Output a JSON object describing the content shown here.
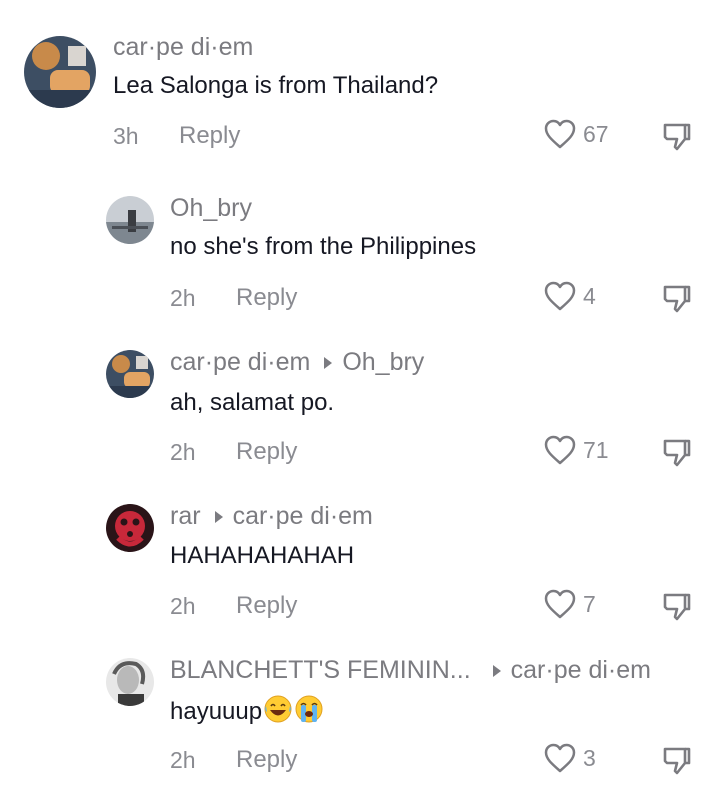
{
  "comments": [
    {
      "username": "car·pe di·em",
      "reply_to": "",
      "text": "Lea Salonga is from Thailand?",
      "time": "3h",
      "reply_label": "Reply",
      "likes": "67",
      "avatar_icon": "user-photo-avatar"
    },
    {
      "username": "Oh_bry",
      "reply_to": "",
      "text": "no she's from the Philippines",
      "time": "2h",
      "reply_label": "Reply",
      "likes": "4",
      "avatar_icon": "user-photo-avatar"
    },
    {
      "username": "car·pe di·em",
      "reply_to": "Oh_bry",
      "text": "ah, salamat po.",
      "time": "2h",
      "reply_label": "Reply",
      "likes": "71",
      "avatar_icon": "user-photo-avatar"
    },
    {
      "username": "rar",
      "reply_to": "car·pe di·em",
      "text": "HAHAHAHAHAH",
      "time": "2h",
      "reply_label": "Reply",
      "likes": "7",
      "avatar_icon": "user-photo-avatar"
    },
    {
      "username": "BLANCHETT'S FEMININ...",
      "reply_to": "car·pe di·em",
      "text": "hayuuup",
      "emojis": [
        "laughing-tears-emoji",
        "crying-emoji"
      ],
      "time": "2h",
      "reply_label": "Reply",
      "likes": "3",
      "avatar_icon": "user-photo-avatar"
    }
  ],
  "colors": {
    "primary_text": "#161823",
    "secondary_text": "#7b7b80",
    "background": "#ffffff"
  }
}
